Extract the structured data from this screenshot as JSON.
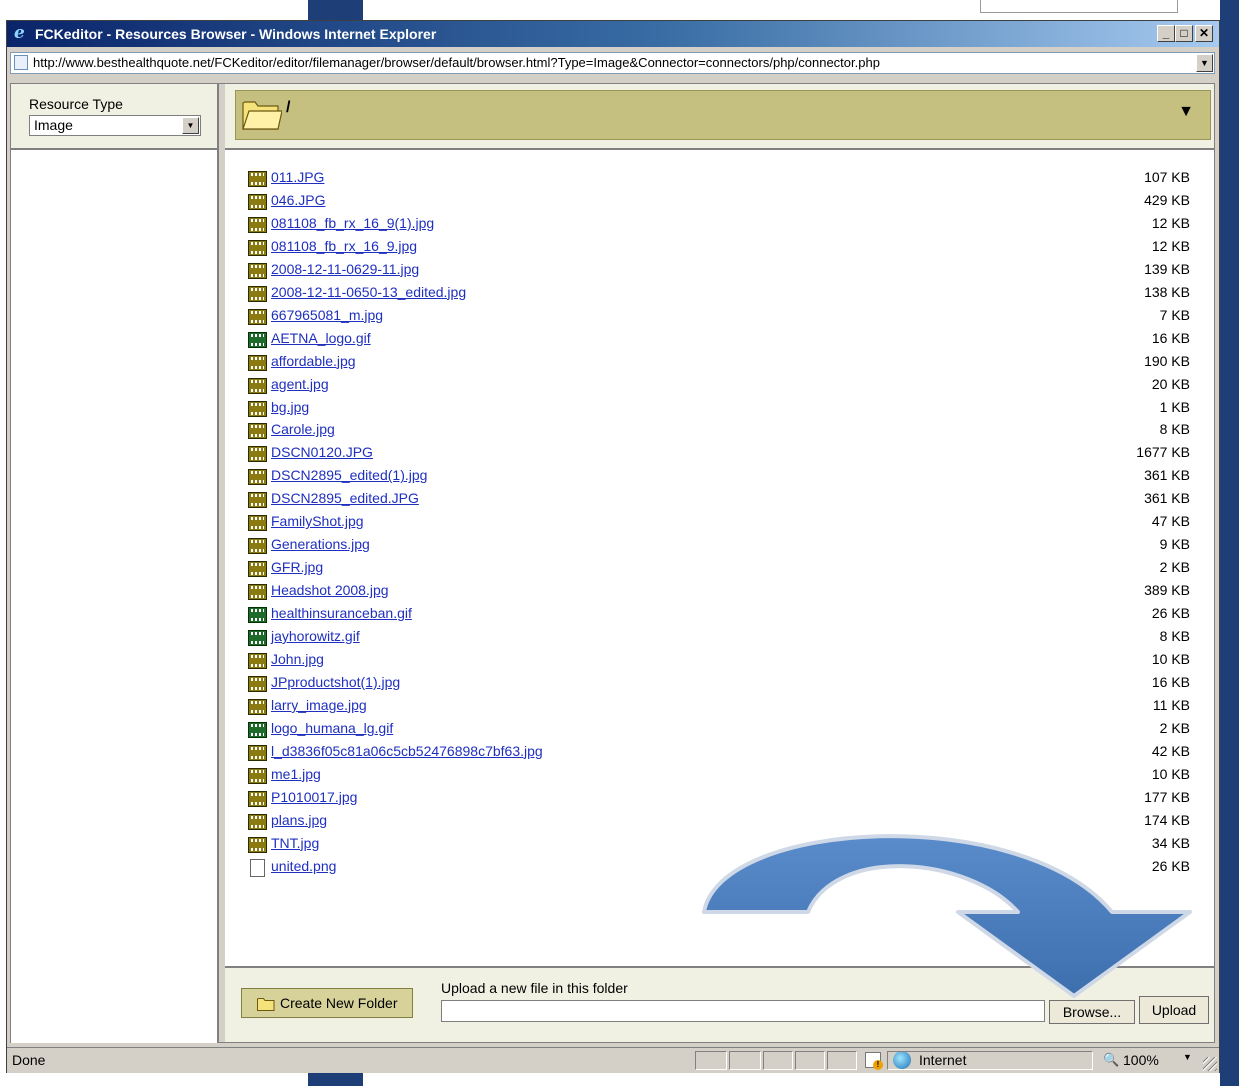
{
  "window": {
    "title": "FCKeditor - Resources Browser - Windows Internet Explorer",
    "minimize_label": "_",
    "maximize_label": "□",
    "close_label": "✕"
  },
  "address": {
    "url": "http://www.besthealthquote.net/FCKeditor/editor/filemanager/browser/default/browser.html?Type=Image&Connector=connectors/php/connector.php"
  },
  "left_panel": {
    "resource_type_label": "Resource Type",
    "resource_type_value": "Image"
  },
  "folder_header": {
    "current_path": "/"
  },
  "files": [
    {
      "name": "011.JPG",
      "size": "107 KB",
      "type": "jpg"
    },
    {
      "name": "046.JPG",
      "size": "429 KB",
      "type": "jpg"
    },
    {
      "name": "081108_fb_rx_16_9(1).jpg",
      "size": "12 KB",
      "type": "jpg"
    },
    {
      "name": "081108_fb_rx_16_9.jpg",
      "size": "12 KB",
      "type": "jpg"
    },
    {
      "name": "2008-12-11-0629-11.jpg",
      "size": "139 KB",
      "type": "jpg"
    },
    {
      "name": "2008-12-11-0650-13_edited.jpg",
      "size": "138 KB",
      "type": "jpg"
    },
    {
      "name": "667965081_m.jpg",
      "size": "7 KB",
      "type": "jpg"
    },
    {
      "name": "AETNA_logo.gif",
      "size": "16 KB",
      "type": "gif"
    },
    {
      "name": "affordable.jpg",
      "size": "190 KB",
      "type": "jpg"
    },
    {
      "name": "agent.jpg",
      "size": "20 KB",
      "type": "jpg"
    },
    {
      "name": "bg.jpg",
      "size": "1 KB",
      "type": "jpg"
    },
    {
      "name": "Carole.jpg",
      "size": "8 KB",
      "type": "jpg"
    },
    {
      "name": "DSCN0120.JPG",
      "size": "1677 KB",
      "type": "jpg"
    },
    {
      "name": "DSCN2895_edited(1).jpg",
      "size": "361 KB",
      "type": "jpg"
    },
    {
      "name": "DSCN2895_edited.JPG",
      "size": "361 KB",
      "type": "jpg"
    },
    {
      "name": "FamilyShot.jpg",
      "size": "47 KB",
      "type": "jpg"
    },
    {
      "name": "Generations.jpg",
      "size": "9 KB",
      "type": "jpg"
    },
    {
      "name": "GFR.jpg",
      "size": "2 KB",
      "type": "jpg"
    },
    {
      "name": "Headshot 2008.jpg",
      "size": "389 KB",
      "type": "jpg"
    },
    {
      "name": "healthinsuranceban.gif",
      "size": "26 KB",
      "type": "gif"
    },
    {
      "name": "jayhorowitz.gif",
      "size": "8 KB",
      "type": "gif"
    },
    {
      "name": "John.jpg",
      "size": "10 KB",
      "type": "jpg"
    },
    {
      "name": "JPproductshot(1).jpg",
      "size": "16 KB",
      "type": "jpg"
    },
    {
      "name": "larry_image.jpg",
      "size": "11 KB",
      "type": "jpg"
    },
    {
      "name": "logo_humana_lg.gif",
      "size": "2 KB",
      "type": "gif"
    },
    {
      "name": "l_d3836f05c81a06c5cb52476898c7bf63.jpg",
      "size": "42 KB",
      "type": "jpg"
    },
    {
      "name": "me1.jpg",
      "size": "10 KB",
      "type": "jpg"
    },
    {
      "name": "P1010017.jpg",
      "size": "177 KB",
      "type": "jpg"
    },
    {
      "name": "plans.jpg",
      "size": "174 KB",
      "type": "jpg"
    },
    {
      "name": "TNT.jpg",
      "size": "34 KB",
      "type": "jpg"
    },
    {
      "name": "united.png",
      "size": "26 KB",
      "type": "png"
    }
  ],
  "bottom": {
    "create_folder_label": "Create New Folder",
    "upload_label": "Upload a new file in this folder",
    "browse_label": "Browse...",
    "upload_button_label": "Upload"
  },
  "statusbar": {
    "status": "Done",
    "zone": "Internet",
    "zoom": "100%"
  },
  "icons": {
    "file_jpg": "jpg-file-icon",
    "file_gif": "gif-file-icon",
    "file_png": "blank-file-icon",
    "folder": "folder-icon"
  },
  "colors": {
    "title_gradient_start": "#0a246a",
    "link": "#1f2fbf",
    "folder_bar": "#c5c080",
    "arrow": "#4f81bd"
  }
}
